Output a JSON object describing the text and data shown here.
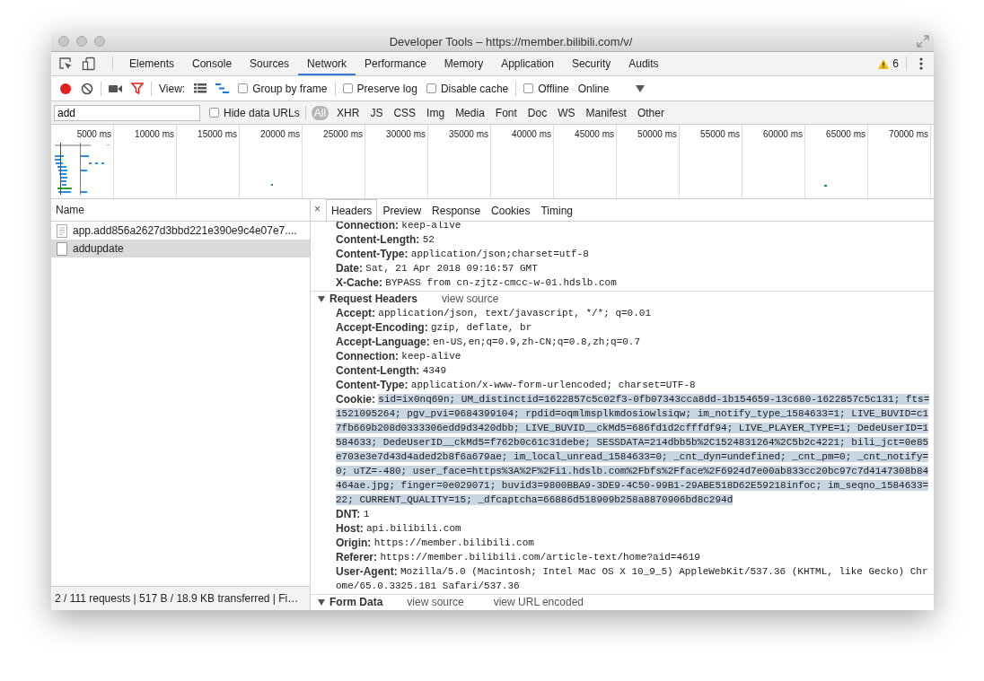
{
  "window": {
    "title": "Developer Tools – https://member.bilibili.com/v/"
  },
  "tabs": [
    {
      "label": "Elements",
      "selected": false
    },
    {
      "label": "Console",
      "selected": false
    },
    {
      "label": "Sources",
      "selected": false
    },
    {
      "label": "Network",
      "selected": true
    },
    {
      "label": "Performance",
      "selected": false
    },
    {
      "label": "Memory",
      "selected": false
    },
    {
      "label": "Application",
      "selected": false
    },
    {
      "label": "Security",
      "selected": false
    },
    {
      "label": "Audits",
      "selected": false
    }
  ],
  "warnings": "6",
  "toolbar": {
    "recording": true,
    "view_label": "View:",
    "large_rows": false,
    "waterfall": true,
    "options": [
      {
        "label": "Group by frame",
        "checked": false
      },
      {
        "label": "Preserve log",
        "checked": false
      },
      {
        "label": "Disable cache",
        "checked": false
      },
      {
        "label": "Offline",
        "checked": false
      }
    ],
    "throttle": "Online"
  },
  "filter": {
    "value": "add",
    "hide_data_urls": {
      "label": "Hide data URLs",
      "checked": false
    },
    "types": [
      {
        "label": "All",
        "selected": true
      },
      {
        "label": "XHR",
        "selected": false
      },
      {
        "label": "JS",
        "selected": false
      },
      {
        "label": "CSS",
        "selected": false
      },
      {
        "label": "Img",
        "selected": false
      },
      {
        "label": "Media",
        "selected": false
      },
      {
        "label": "Font",
        "selected": false
      },
      {
        "label": "Doc",
        "selected": false
      },
      {
        "label": "WS",
        "selected": false
      },
      {
        "label": "Manifest",
        "selected": false
      },
      {
        "label": "Other",
        "selected": false
      }
    ]
  },
  "overview": {
    "ticks": [
      "5000 ms",
      "10000 ms",
      "15000 ms",
      "20000 ms",
      "25000 ms",
      "30000 ms",
      "35000 ms",
      "40000 ms",
      "45000 ms",
      "50000 ms",
      "55000 ms",
      "60000 ms",
      "65000 ms",
      "70000 ms"
    ]
  },
  "requests": {
    "column": "Name",
    "rows": [
      {
        "name": "app.add856a2627d3bbd221e390e9c4e07e7....",
        "kind": "script",
        "selected": false
      },
      {
        "name": "addupdate",
        "kind": "document",
        "selected": true
      }
    ]
  },
  "detail": {
    "close": "×",
    "tabs": [
      {
        "label": "Headers",
        "selected": true
      },
      {
        "label": "Preview",
        "selected": false
      },
      {
        "label": "Response",
        "selected": false
      },
      {
        "label": "Cookies",
        "selected": false
      },
      {
        "label": "Timing",
        "selected": false
      }
    ],
    "response_headers": [
      {
        "name": "Connection:",
        "value": "keep-alive"
      },
      {
        "name": "Content-Length:",
        "value": "52"
      },
      {
        "name": "Content-Type:",
        "value": "application/json;charset=utf-8"
      },
      {
        "name": "Date:",
        "value": "Sat, 21 Apr 2018 09:16:57 GMT"
      },
      {
        "name": "X-Cache:",
        "value": "BYPASS from cn-zjtz-cmcc-w-01.hdslb.com"
      }
    ],
    "request_headers": {
      "title": "Request Headers",
      "expanded": true,
      "links": [
        "view source"
      ],
      "items": [
        {
          "name": "Accept:",
          "value": "application/json, text/javascript, */*; q=0.01",
          "selected": false
        },
        {
          "name": "Accept-Encoding:",
          "value": "gzip, deflate, br",
          "selected": false
        },
        {
          "name": "Accept-Language:",
          "value": "en-US,en;q=0.9,zh-CN;q=0.8,zh;q=0.7",
          "selected": false
        },
        {
          "name": "Connection:",
          "value": "keep-alive",
          "selected": false
        },
        {
          "name": "Content-Length:",
          "value": "4349",
          "selected": false
        },
        {
          "name": "Content-Type:",
          "value": "application/x-www-form-urlencoded; charset=UTF-8",
          "selected": false
        },
        {
          "name": "Cookie:",
          "value": "sid=ix0nq69n; UM_distinctid=1622857c5c02f3-0fb07343cca8dd-1b154659-13c680-1622857c5c131; fts=1521095264; pgv_pvi=9684399104; rpdid=oqmlmsplkmdosiowlsiqw; im_notify_type_1584633=1; LIVE_BUVID=c17fb669b208d0333306edd9d3420dbb; LIVE_BUVID__ckMd5=686fd1d2cfffdf94; LIVE_PLAYER_TYPE=1; DedeUserID=1584633; DedeUserID__ckMd5=f762b0c61c31debe; SESSDATA=214dbb5b%2C1524831264%2C5b2c4221; bili_jct=0e85e703e3e7d43d4aded2b8f6a679ae; im_local_unread_1584633=0; _cnt_dyn=undefined; _cnt_pm=0; _cnt_notify=0; uTZ=-480; user_face=https%3A%2F%2Fi1.hdslb.com%2Fbfs%2Fface%2F6924d7e00ab833cc20bc97c7d4147308b84464ae.jpg; finger=0e029071; buvid3=9800BBA9-3DE9-4C50-99B1-29ABE518D62E59218infoc; im_seqno_1584633=22; CURRENT_QUALITY=15; _dfcaptcha=66886d518909b258a8870906bd8c294d",
          "selected": true
        },
        {
          "name": "DNT:",
          "value": "1",
          "selected": false
        },
        {
          "name": "Host:",
          "value": "api.bilibili.com",
          "selected": false
        },
        {
          "name": "Origin:",
          "value": "https://member.bilibili.com",
          "selected": false
        },
        {
          "name": "Referer:",
          "value": "https://member.bilibili.com/article-text/home?aid=4619",
          "selected": false
        },
        {
          "name": "User-Agent:",
          "value": "Mozilla/5.0 (Macintosh; Intel Mac OS X 10_9_5) AppleWebKit/537.36 (KHTML, like Gecko) Chrome/65.0.3325.181 Safari/537.36",
          "selected": false
        }
      ]
    },
    "form_data": {
      "title": "Form Data",
      "expanded": true,
      "links": [
        "view source",
        "view URL encoded"
      ]
    }
  },
  "status_bar": "2 / 111 requests | 517 B / 18.9 KB transferred | Fi…"
}
